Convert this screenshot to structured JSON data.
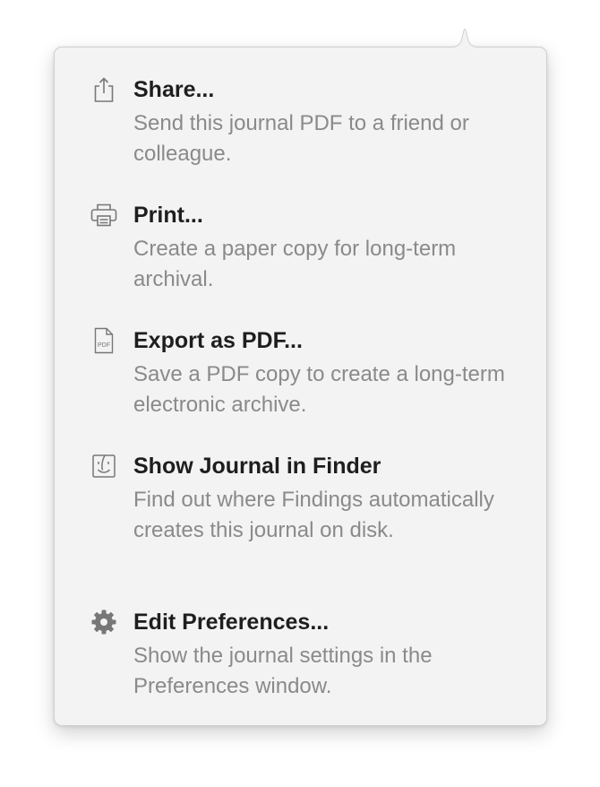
{
  "menu": {
    "items": [
      {
        "icon": "share-icon",
        "title": "Share...",
        "description": "Send this journal PDF to a friend or colleague."
      },
      {
        "icon": "printer-icon",
        "title": "Print...",
        "description": "Create a paper copy for long-term archival."
      },
      {
        "icon": "pdf-document-icon",
        "icon_label": "PDF",
        "title": "Export as PDF...",
        "description": "Save a PDF copy to create a long-term electronic archive."
      },
      {
        "icon": "finder-icon",
        "title": "Show Journal in Finder",
        "description": "Find out where Findings automatically creates this journal on disk."
      },
      {
        "icon": "gear-icon",
        "title": "Edit Preferences...",
        "description": "Show the journal settings in the Preferences window."
      }
    ]
  },
  "colors": {
    "background": "#f3f3f3",
    "title": "#1e1e1e",
    "description": "#8a8a8a",
    "icon": "#777777"
  }
}
